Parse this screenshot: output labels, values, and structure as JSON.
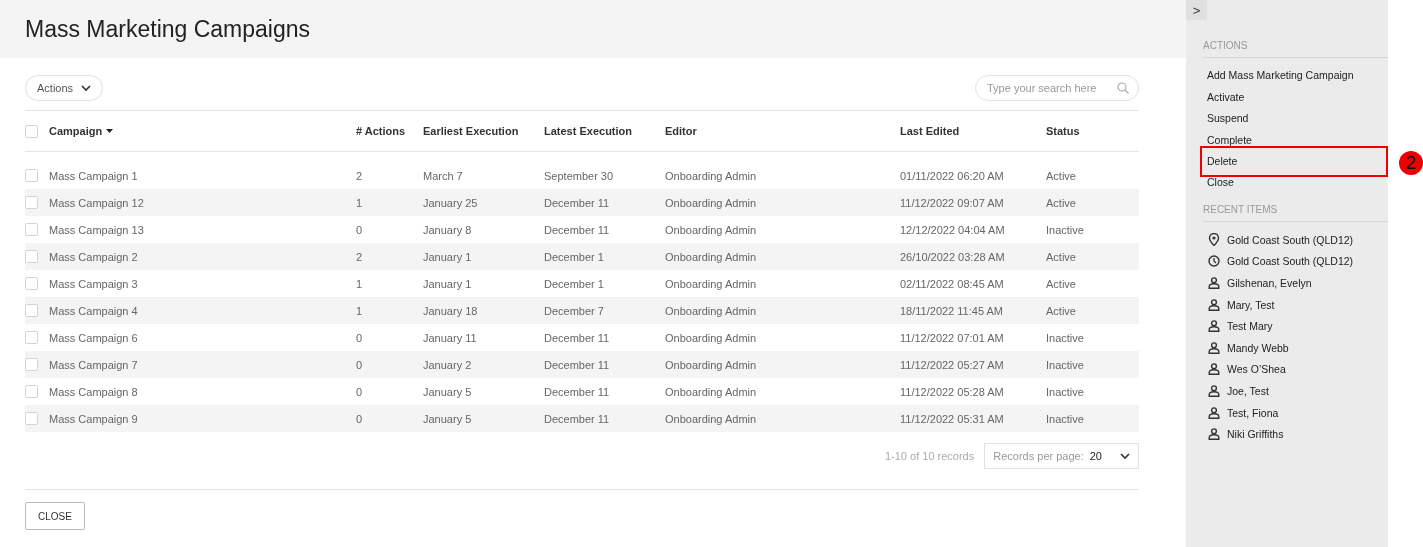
{
  "page": {
    "title": "Mass Marketing Campaigns"
  },
  "toolbar": {
    "actions_label": "Actions",
    "search": {
      "placeholder": "Type your search here"
    }
  },
  "table": {
    "header_checked": false,
    "columns": [
      {
        "label": "Campaign",
        "sorted": true
      },
      {
        "label": "# Actions",
        "sorted": false
      },
      {
        "label": "Earliest Execution",
        "sorted": false
      },
      {
        "label": "Latest Execution",
        "sorted": false
      },
      {
        "label": "Editor",
        "sorted": false
      },
      {
        "label": "Last Edited",
        "sorted": false
      },
      {
        "label": "Status",
        "sorted": false
      }
    ],
    "rows": [
      {
        "checked": false,
        "cells": [
          "Mass Campaign 1",
          "2",
          "March 7",
          "September 30",
          "Onboarding Admin",
          "01/11/2022 06:20 AM",
          "Active"
        ]
      },
      {
        "checked": false,
        "cells": [
          "Mass Campaign 12",
          "1",
          "January 25",
          "December 11",
          "Onboarding Admin",
          "11/12/2022 09:07 AM",
          "Active"
        ]
      },
      {
        "checked": false,
        "cells": [
          "Mass Campaign 13",
          "0",
          "January 8",
          "December 11",
          "Onboarding Admin",
          "12/12/2022 04:04 AM",
          "Inactive"
        ]
      },
      {
        "checked": false,
        "cells": [
          "Mass Campaign 2",
          "2",
          "January 1",
          "December 1",
          "Onboarding Admin",
          "26/10/2022 03:28 AM",
          "Active"
        ]
      },
      {
        "checked": false,
        "cells": [
          "Mass Campaign 3",
          "1",
          "January 1",
          "December 1",
          "Onboarding Admin",
          "02/11/2022 08:45 AM",
          "Active"
        ]
      },
      {
        "checked": false,
        "cells": [
          "Mass Campaign 4",
          "1",
          "January 18",
          "December 7",
          "Onboarding Admin",
          "18/11/2022 11:45 AM",
          "Active"
        ]
      },
      {
        "checked": false,
        "cells": [
          "Mass Campaign 6",
          "0",
          "January 11",
          "December 11",
          "Onboarding Admin",
          "11/12/2022 07:01 AM",
          "Inactive"
        ]
      },
      {
        "checked": false,
        "cells": [
          "Mass Campaign 7",
          "0",
          "January 2",
          "December 11",
          "Onboarding Admin",
          "11/12/2022 05:27 AM",
          "Inactive"
        ]
      },
      {
        "checked": false,
        "cells": [
          "Mass Campaign 8",
          "0",
          "January 5",
          "December 11",
          "Onboarding Admin",
          "11/12/2022 05:28 AM",
          "Inactive"
        ]
      },
      {
        "checked": false,
        "cells": [
          "Mass Campaign 9",
          "0",
          "January 5",
          "December 11",
          "Onboarding Admin",
          "11/12/2022 05:31 AM",
          "Inactive"
        ]
      }
    ]
  },
  "pagination": {
    "summary": "1-10 of 10 records",
    "per_page_label": "Records per page:",
    "per_page_value": "20"
  },
  "footer": {
    "close_button": "CLOSE"
  },
  "sidebar": {
    "toggle": ">",
    "actions_heading": "ACTIONS",
    "actions": [
      {
        "label": "Add Mass Marketing Campaign",
        "highlighted": false
      },
      {
        "label": "Activate",
        "highlighted": false
      },
      {
        "label": "Suspend",
        "highlighted": false
      },
      {
        "label": "Complete",
        "highlighted": false
      },
      {
        "label": "Delete",
        "highlighted": true
      },
      {
        "label": "Close",
        "highlighted": false
      }
    ],
    "recent_heading": "RECENT ITEMS",
    "recent_items": [
      {
        "kind": "location",
        "label": "Gold Coast South (QLD12)"
      },
      {
        "kind": "clock",
        "label": "Gold Coast South (QLD12)"
      },
      {
        "kind": "person",
        "label": "Gilshenan, Evelyn"
      },
      {
        "kind": "person",
        "label": "Mary, Test"
      },
      {
        "kind": "person",
        "label": "Test Mary"
      },
      {
        "kind": "person",
        "label": "Mandy Webb"
      },
      {
        "kind": "person",
        "label": "Wes O’Shea"
      },
      {
        "kind": "person",
        "label": "Joe, Test"
      },
      {
        "kind": "person",
        "label": "Test, Fiona"
      },
      {
        "kind": "person",
        "label": "Niki Griffiths"
      }
    ]
  },
  "callout": {
    "number": "2"
  }
}
